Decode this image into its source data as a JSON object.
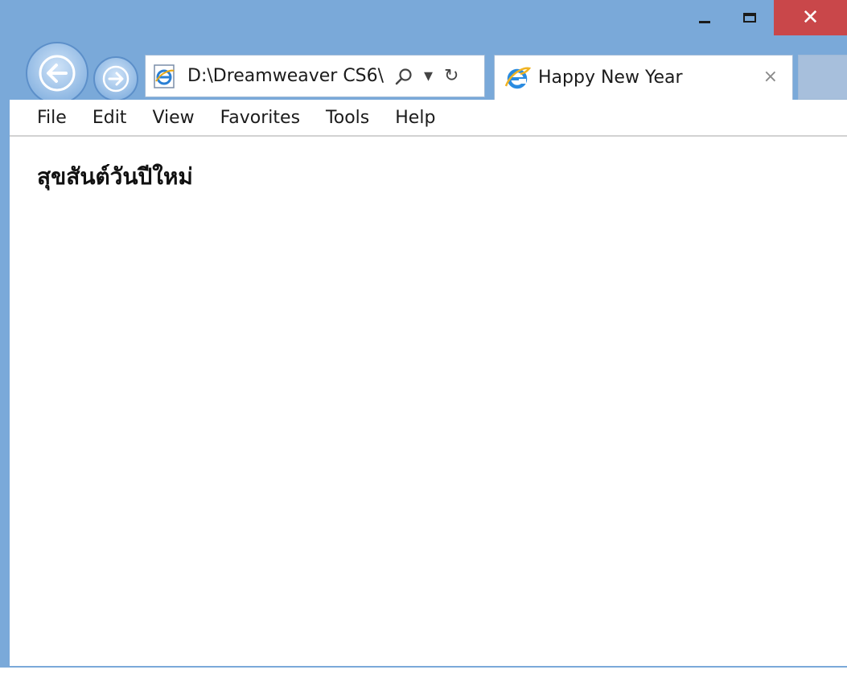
{
  "window": {
    "minimize_icon": "minimize-icon",
    "maximize_icon": "maximize-icon",
    "close_icon": "close-icon",
    "close_glyph": "✕",
    "frame_color": "#7aa9d9",
    "close_color": "#c9474a"
  },
  "nav": {
    "back_icon": "arrow-left-icon",
    "forward_icon": "arrow-right-icon"
  },
  "address_bar": {
    "value": "D:\\Dreamweaver CS6\\",
    "search_icon": "search-icon",
    "dropdown_glyph": "▾",
    "refresh_glyph": "↻"
  },
  "tab": {
    "title": "Happy New Year",
    "close_glyph": "×"
  },
  "menu": {
    "items": [
      "File",
      "Edit",
      "View",
      "Favorites",
      "Tools",
      "Help"
    ]
  },
  "page": {
    "heading": "สุขสันต์วันปีใหม่"
  }
}
